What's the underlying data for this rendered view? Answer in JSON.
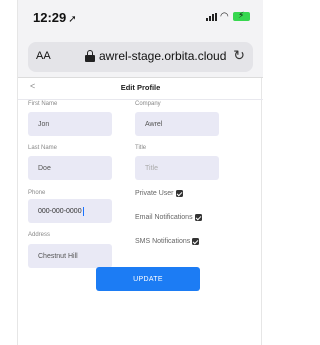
{
  "status_bar": {
    "time": "12:29"
  },
  "browser": {
    "text_size": "AA",
    "url": "awrel-stage.orbita.cloud"
  },
  "header": {
    "back": "<",
    "title": "Edit Profile"
  },
  "form": {
    "first_name": {
      "label": "First Name",
      "value": "Jon"
    },
    "last_name": {
      "label": "Last Name",
      "value": "Doe"
    },
    "phone": {
      "label": "Phone",
      "value": "000-000-0000"
    },
    "address": {
      "label": "Address",
      "value": "Chestnut Hill"
    },
    "company": {
      "label": "Company",
      "value": "Awrel"
    },
    "title": {
      "label": "Title",
      "placeholder": "Title"
    },
    "private_user": {
      "label": "Private User",
      "checked": true
    },
    "email_notifications": {
      "label": "Email Notifications",
      "checked": true
    },
    "sms_notifications": {
      "label": "SMS Notifications",
      "checked": true
    },
    "update_label": "UPDATE"
  },
  "colors": {
    "accent": "#1c7cf4",
    "field_bg": "#e9e9f5",
    "battery": "#37d74f"
  }
}
